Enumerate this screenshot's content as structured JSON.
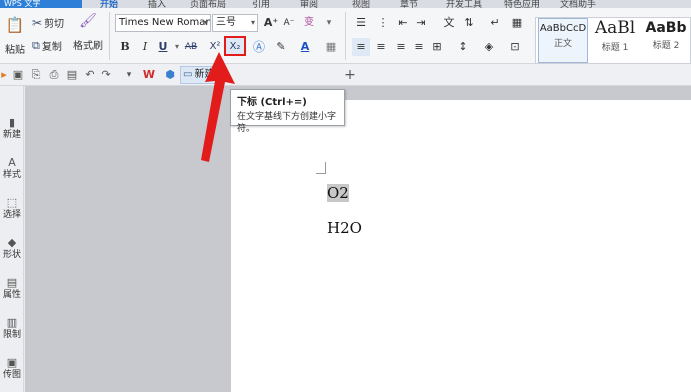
{
  "menu": {
    "app_tab": "WPS 文字",
    "tabs": [
      "开始",
      "插入",
      "页面布局",
      "引用",
      "审阅",
      "视图",
      "章节",
      "开发工具",
      "特色应用",
      "文档助手"
    ],
    "active_tab": "开始"
  },
  "ribbon": {
    "paste_label": "粘贴",
    "cut_label": "剪切",
    "copy_label": "复制",
    "format_painter_label": "格式刷",
    "font_name": "Times New Roman",
    "font_size": "三号",
    "bold": "B",
    "italic": "I",
    "underline": "U",
    "strikethrough": "AB",
    "superscript": "X²",
    "subscript": "X₂",
    "grow_font": "A⁺",
    "shrink_font": "A⁻",
    "clear_format": "变",
    "font_color": "A"
  },
  "styles": [
    {
      "sample": "AaBbCcD",
      "caption": "正文"
    },
    {
      "sample": "AaBl",
      "caption": "标题 1"
    },
    {
      "sample": "AaBb",
      "caption": "标题 2"
    }
  ],
  "quickbar": {
    "new_label": "新建"
  },
  "sidebar": {
    "items": [
      {
        "icon": "new-icon",
        "label": "新建"
      },
      {
        "icon": "style-icon",
        "label": "样式"
      },
      {
        "icon": "select-icon",
        "label": "选择"
      },
      {
        "icon": "shape-icon",
        "label": "形状"
      },
      {
        "icon": "properties-icon",
        "label": "属性"
      },
      {
        "icon": "restrict-icon",
        "label": "限制"
      },
      {
        "icon": "transfer-icon",
        "label": "传图"
      }
    ]
  },
  "document": {
    "line1": "O2",
    "line2": "H2O"
  },
  "tooltip": {
    "title": "下标 (Ctrl+=)",
    "description": "在文字基线下方创建小字符。"
  },
  "colors": {
    "accent": "#2e7fd8",
    "highlight": "#e21b1b"
  }
}
